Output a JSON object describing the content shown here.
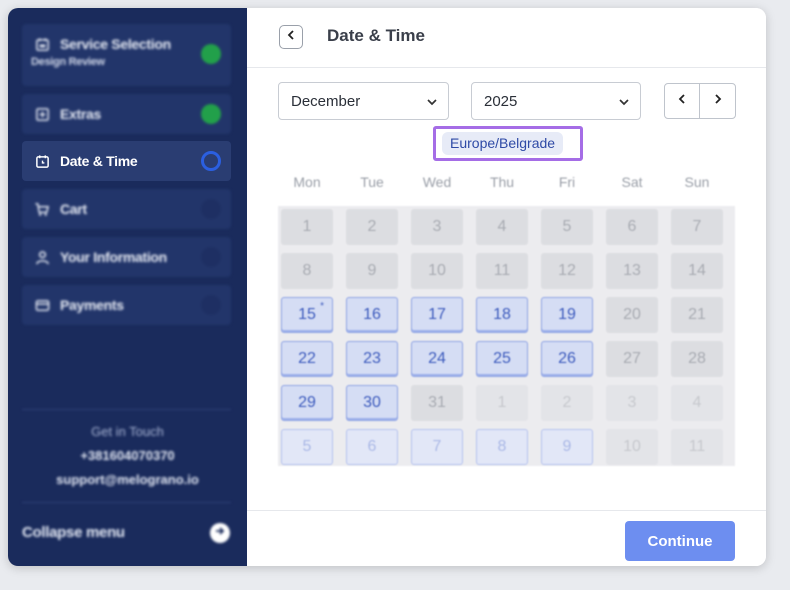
{
  "sidebar": {
    "steps": [
      {
        "label": "Service Selection",
        "sub": "Design Review",
        "icon": "calendar-service-icon",
        "status": "done"
      },
      {
        "label": "Extras",
        "icon": "plus-square-icon",
        "status": "done"
      },
      {
        "label": "Date & Time",
        "icon": "calendar-clock-icon",
        "status": "current"
      },
      {
        "label": "Cart",
        "icon": "cart-icon",
        "status": "todo"
      },
      {
        "label": "Your Information",
        "icon": "user-icon",
        "status": "todo"
      },
      {
        "label": "Payments",
        "icon": "credit-card-icon",
        "status": "todo"
      }
    ],
    "contact_title": "Get in Touch",
    "phone": "+381604070370",
    "email": "support@melograno.io",
    "collapse_label": "Collapse menu"
  },
  "main": {
    "title": "Date & Time",
    "month": "December",
    "year": "2025",
    "timezone": "Europe/Belgrade",
    "weekdays": [
      "Mon",
      "Tue",
      "Wed",
      "Thu",
      "Fri",
      "Sat",
      "Sun"
    ],
    "weeks": [
      [
        [
          "1",
          "disabled"
        ],
        [
          "2",
          "disabled"
        ],
        [
          "3",
          "disabled"
        ],
        [
          "4",
          "disabled"
        ],
        [
          "5",
          "disabled"
        ],
        [
          "6",
          "disabled"
        ],
        [
          "7",
          "disabled"
        ]
      ],
      [
        [
          "8",
          "disabled"
        ],
        [
          "9",
          "disabled"
        ],
        [
          "10",
          "disabled"
        ],
        [
          "11",
          "disabled"
        ],
        [
          "12",
          "disabled"
        ],
        [
          "13",
          "disabled"
        ],
        [
          "14",
          "disabled"
        ]
      ],
      [
        [
          "15",
          "avail"
        ],
        [
          "16",
          "avail"
        ],
        [
          "17",
          "avail"
        ],
        [
          "18",
          "avail"
        ],
        [
          "19",
          "avail"
        ],
        [
          "20",
          "disabled"
        ],
        [
          "21",
          "disabled"
        ]
      ],
      [
        [
          "22",
          "avail"
        ],
        [
          "23",
          "avail"
        ],
        [
          "24",
          "avail"
        ],
        [
          "25",
          "avail"
        ],
        [
          "26",
          "avail"
        ],
        [
          "27",
          "disabled"
        ],
        [
          "28",
          "disabled"
        ]
      ],
      [
        [
          "29",
          "avail"
        ],
        [
          "30",
          "avail"
        ],
        [
          "31",
          "disabled"
        ],
        [
          "1",
          "faded"
        ],
        [
          "2",
          "faded"
        ],
        [
          "3",
          "faded"
        ],
        [
          "4",
          "faded"
        ]
      ],
      [
        [
          "5",
          "avail-faded"
        ],
        [
          "6",
          "avail-faded"
        ],
        [
          "7",
          "avail-faded"
        ],
        [
          "8",
          "avail-faded"
        ],
        [
          "9",
          "avail-faded"
        ],
        [
          "10",
          "faded"
        ],
        [
          "11",
          "faded"
        ]
      ]
    ],
    "today_marker": "*",
    "continue_label": "Continue"
  },
  "colors": {
    "sidebar_bg": "#1a2b5c",
    "done": "#22a04a",
    "current_ring": "#2b5fe0",
    "accent": "#6d8ef0",
    "timezone_highlight": "#a56de6"
  }
}
